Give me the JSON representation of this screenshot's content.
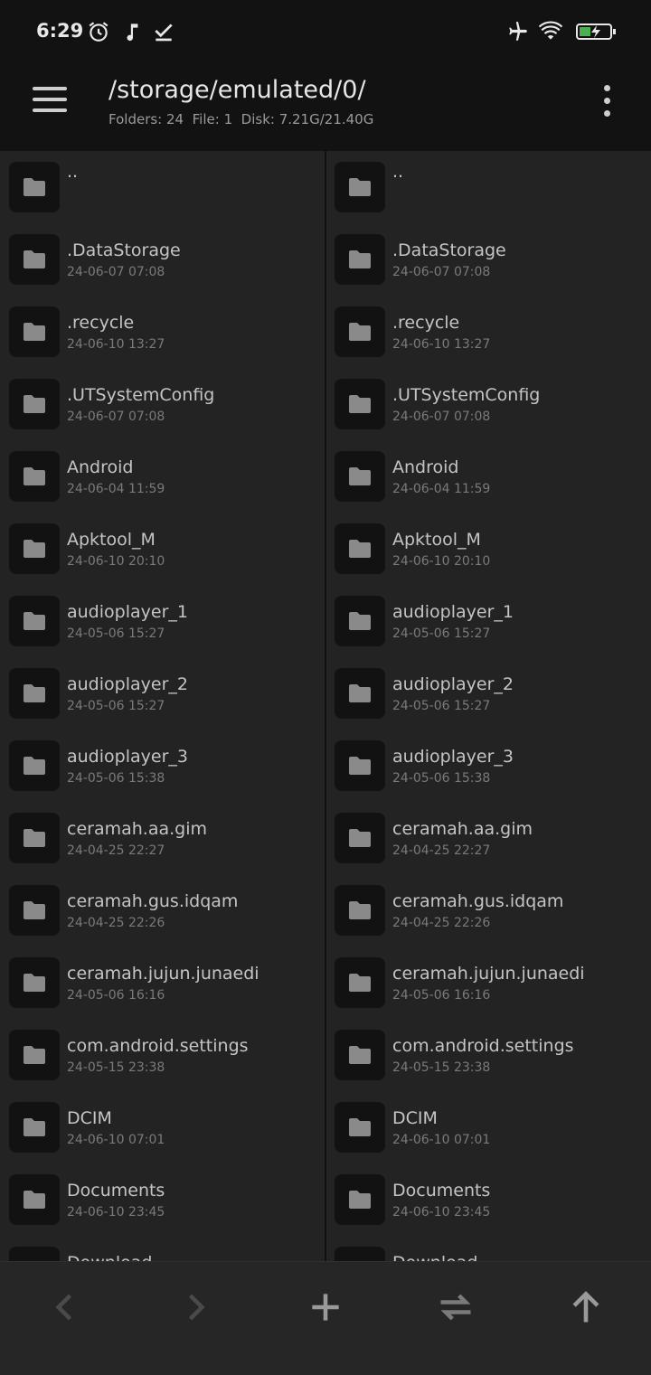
{
  "status_bar": {
    "time": "6:29",
    "left_icons": [
      "alarm-icon",
      "music-note-icon",
      "download-done-icon"
    ],
    "right_icons": [
      "airplane-icon",
      "wifi-icon",
      "battery-charging-icon"
    ]
  },
  "app_bar": {
    "path": "/storage/emulated/0/",
    "folders": "Folders: 24",
    "files": "File: 1",
    "disk": "Disk: 7.21G/21.40G",
    "menu_icon": "hamburger-menu-icon",
    "more_icon": "more-vert-icon"
  },
  "files": [
    {
      "name": "..",
      "date": ""
    },
    {
      "name": ".DataStorage",
      "date": "24-06-07 07:08"
    },
    {
      "name": ".recycle",
      "date": "24-06-10 13:27"
    },
    {
      "name": ".UTSystemConfig",
      "date": "24-06-07 07:08"
    },
    {
      "name": "Android",
      "date": "24-06-04 11:59"
    },
    {
      "name": "Apktool_M",
      "date": "24-06-10 20:10"
    },
    {
      "name": "audioplayer_1",
      "date": "24-05-06 15:27"
    },
    {
      "name": "audioplayer_2",
      "date": "24-05-06 15:27"
    },
    {
      "name": "audioplayer_3",
      "date": "24-05-06 15:38"
    },
    {
      "name": "ceramah.aa.gim",
      "date": "24-04-25 22:27"
    },
    {
      "name": "ceramah.gus.idqam",
      "date": "24-04-25 22:26"
    },
    {
      "name": "ceramah.jujun.junaedi",
      "date": "24-05-06 16:16"
    },
    {
      "name": "com.android.settings",
      "date": "24-05-15 23:38"
    },
    {
      "name": "DCIM",
      "date": "24-06-10 07:01"
    },
    {
      "name": "Documents",
      "date": "24-06-10 23:45"
    },
    {
      "name": "Download",
      "date": ""
    }
  ],
  "bottom_bar": {
    "buttons": [
      "back-arrow-icon",
      "forward-arrow-icon",
      "add-icon",
      "swap-icon",
      "up-arrow-icon"
    ]
  },
  "colors": {
    "background": "#222222",
    "bar": "#121212",
    "icon_box": "#121212"
  }
}
